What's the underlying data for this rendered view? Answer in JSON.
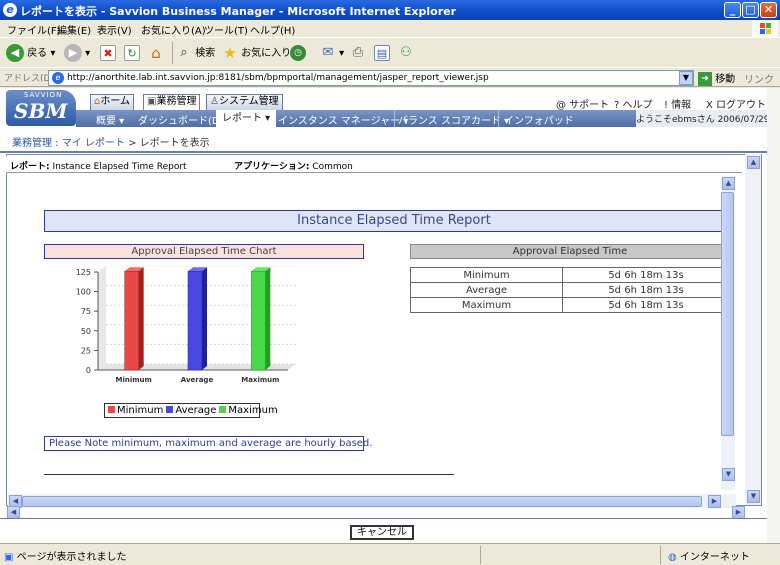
{
  "window": {
    "title": "レポートを表示 - Savvion Business Manager - Microsoft Internet Explorer"
  },
  "menu": [
    "ファイル(F)",
    "編集(E)",
    "表示(V)",
    "お気に入り(A)",
    "ツール(T)",
    "ヘルプ(H)"
  ],
  "toolbar": {
    "back": "戻る",
    "search": "検索",
    "favorites": "お気に入り"
  },
  "address": {
    "label": "アドレス(D)",
    "url": "http://anorthite.lab.int.savvion.jp:8181/sbm/bpmportal/management/jasper_report_viewer.jsp",
    "go": "移動",
    "links": "リンク"
  },
  "app": {
    "logo_top": "SAVVION",
    "logo_main": "SBM",
    "tabs": [
      "ホーム",
      "業務管理",
      "システム管理"
    ],
    "top_links": [
      "サポート",
      "ヘルプ",
      "情報",
      "ログアウト"
    ],
    "subnav": [
      "概要",
      "ダッシュボード(D)",
      "レポート",
      "インスタンス マネージャー",
      "バランス スコアカード",
      "インフォパッド"
    ],
    "welcome": "ようこそebmsさん  2006/07/29"
  },
  "breadcrumb": {
    "root": "業務管理 : マイ レポート",
    "sep": " > ",
    "current": "レポートを表示"
  },
  "report_info": {
    "report_label": "レポート:",
    "report_name": "Instance Elapsed Time Report",
    "app_label": "アプリケーション:",
    "app_name": "Common"
  },
  "report": {
    "title": "Instance Elapsed Time Report",
    "chart_title": "Approval Elapsed Time Chart",
    "table_title": "Approval Elapsed Time",
    "rows": [
      {
        "label": "Minimum",
        "value": "5d 6h 18m 13s"
      },
      {
        "label": "Average",
        "value": "5d 6h 18m 13s"
      },
      {
        "label": "Maximum",
        "value": "5d 6h 18m 13s"
      }
    ],
    "note": "Please Note minimum, maximum and average are hourly based."
  },
  "chart_data": {
    "type": "bar",
    "categories": [
      "Minimum",
      "Average",
      "Maximum"
    ],
    "values": [
      126,
      126,
      126
    ],
    "ylim": [
      0,
      125
    ],
    "yticks": [
      0,
      25,
      50,
      75,
      100,
      125
    ],
    "colors": [
      "#e84848",
      "#4848e0",
      "#48d848"
    ],
    "legend": [
      "Minimum",
      "Average",
      "Maximum"
    ],
    "grid": true,
    "title": "",
    "xlabel": "",
    "ylabel": ""
  },
  "buttons": {
    "cancel": "キャンセル"
  },
  "status": {
    "left": "ページが表示されました",
    "zone": "インターネット"
  }
}
